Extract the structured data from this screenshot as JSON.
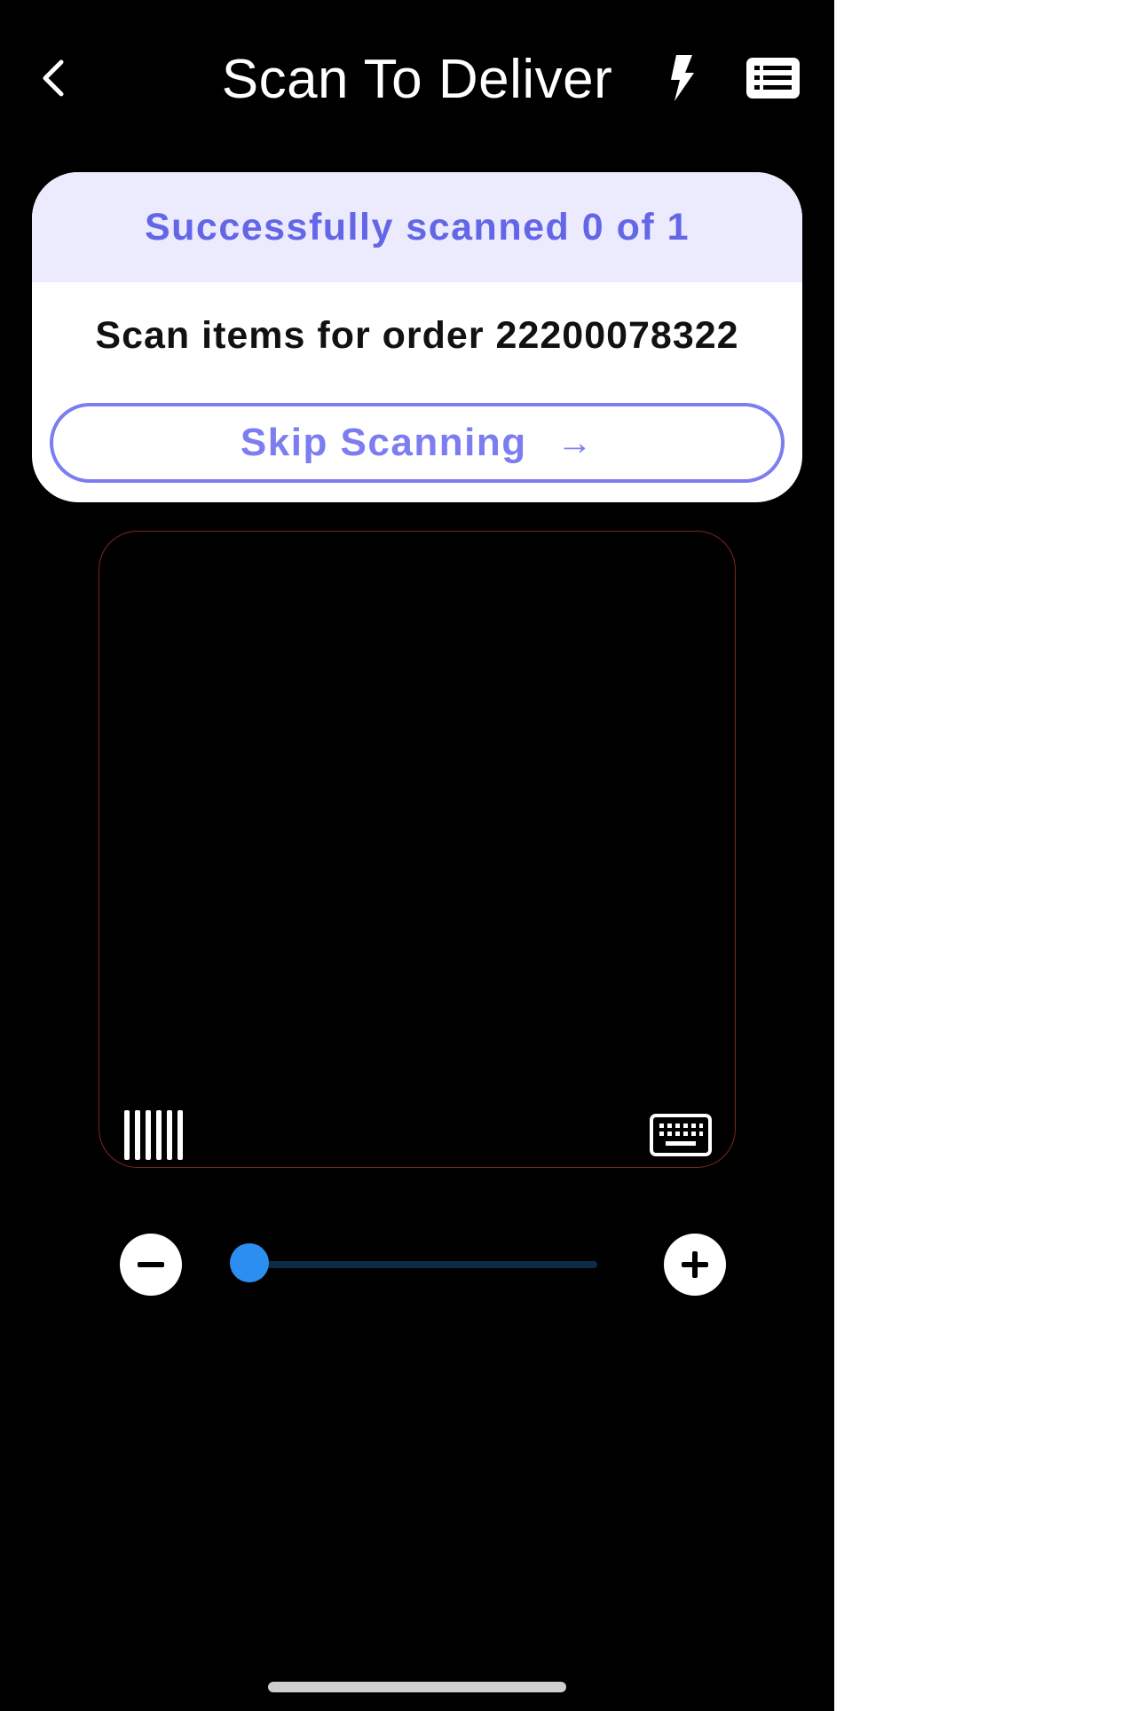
{
  "header": {
    "title": "Scan To Deliver",
    "back_icon": "chevron-left-icon",
    "flash_icon": "flash-icon",
    "list_icon": "list-icon"
  },
  "card": {
    "status": "Successfully scanned 0 of 1",
    "instruction": "Scan items for order 22200078322",
    "skip_label": "Skip Scanning",
    "skip_arrow": "→"
  },
  "scanner": {
    "barcode_icon": "barcode-icon",
    "keyboard_icon": "keyboard-icon"
  },
  "zoom": {
    "level": 0.04,
    "minus_icon": "minus-icon",
    "plus_icon": "plus-icon"
  },
  "colors": {
    "background": "#000000",
    "banner_bg": "#ecebfd",
    "accent": "#6466e8",
    "slider": "#2b8ef0",
    "viewfinder_border": "#7a2a1c"
  }
}
